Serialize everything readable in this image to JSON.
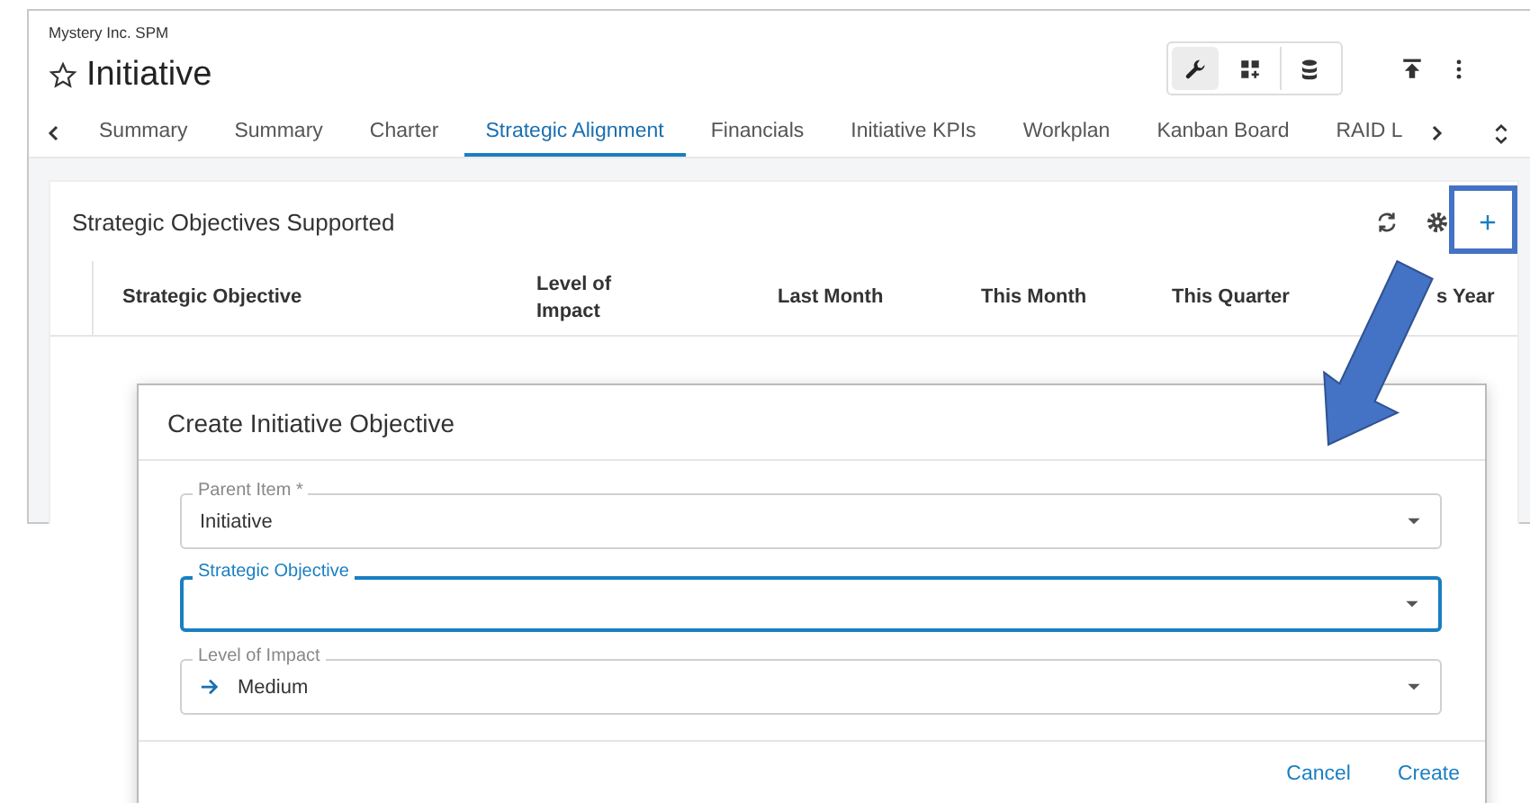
{
  "app": {
    "org": "Mystery Inc. SPM",
    "title": "Initiative",
    "starred": false,
    "toolbar": [
      {
        "kind": "wrench",
        "selected": true
      },
      {
        "kind": "grid-add",
        "selected": false
      },
      {
        "kind": "database",
        "selected": false
      }
    ],
    "actions": [
      {
        "kind": "upload"
      },
      {
        "kind": "more"
      }
    ]
  },
  "tabs": [
    {
      "label": "Summary",
      "selected": false
    },
    {
      "label": "Summary",
      "selected": false
    },
    {
      "label": "Charter",
      "selected": false
    },
    {
      "label": "Strategic Alignment",
      "selected": true
    },
    {
      "label": "Financials",
      "selected": false
    },
    {
      "label": "Initiative KPIs",
      "selected": false
    },
    {
      "label": "Workplan",
      "selected": false
    },
    {
      "label": "Kanban Board",
      "selected": false
    },
    {
      "label": "RAID L",
      "selected": false
    }
  ],
  "panel": {
    "title": "Strategic Objectives Supported",
    "columns": [
      "Strategic Objective",
      "Level of Impact",
      "Last Month",
      "This Month",
      "This Quarter",
      "s Year"
    ]
  },
  "dialog": {
    "title": "Create Initiative Objective",
    "fields": [
      {
        "label": "Parent Item *",
        "value": "Initiative",
        "focused": false,
        "kind": "select"
      },
      {
        "label": "Strategic Objective",
        "focused": true,
        "kind": "select"
      },
      {
        "label": "Level of Impact",
        "value": "Medium",
        "focused": false,
        "kind": "level"
      }
    ],
    "buttons": [
      "Cancel",
      "Create"
    ]
  }
}
